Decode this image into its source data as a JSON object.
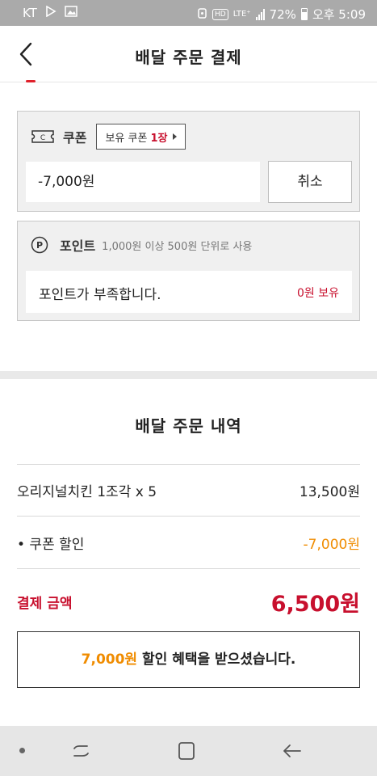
{
  "status_bar": {
    "carrier": "KT",
    "network": "LTE⁺",
    "battery": "72%",
    "time": "오후 5:09"
  },
  "header": {
    "title": "배달 주문 결제"
  },
  "coupon": {
    "label": "쿠폰",
    "owned_prefix": "보유 쿠폰",
    "owned_count": "1장",
    "value": "-7,000원",
    "cancel_label": "취소"
  },
  "points": {
    "label": "포인트",
    "note": "1,000원 이상 500원 단위로 사용",
    "message": "포인트가 부족합니다.",
    "owned": "0원 보유"
  },
  "order": {
    "title": "배달 주문 내역",
    "item": {
      "name": "오리지널치킨 1조각 x 5",
      "price": "13,500원"
    },
    "discount": {
      "name": "• 쿠폰 할인",
      "amount": "-7,000원"
    },
    "total": {
      "label": "결제 금액",
      "amount": "6,500원"
    },
    "benefit": {
      "amount": "7,000원",
      "text": " 할인 혜택을 받으셨습니다."
    }
  },
  "colors": {
    "accent_red": "#c8102e",
    "accent_orange": "#f08c00",
    "status_bar": "#aaaaaa",
    "nav_bar": "#e6e6e6"
  },
  "icons": [
    "chevron-left-icon",
    "coupon-ticket-icon",
    "points-p-icon",
    "caret-right-icon",
    "recent-apps-icon",
    "home-icon",
    "back-arrow-icon"
  ]
}
